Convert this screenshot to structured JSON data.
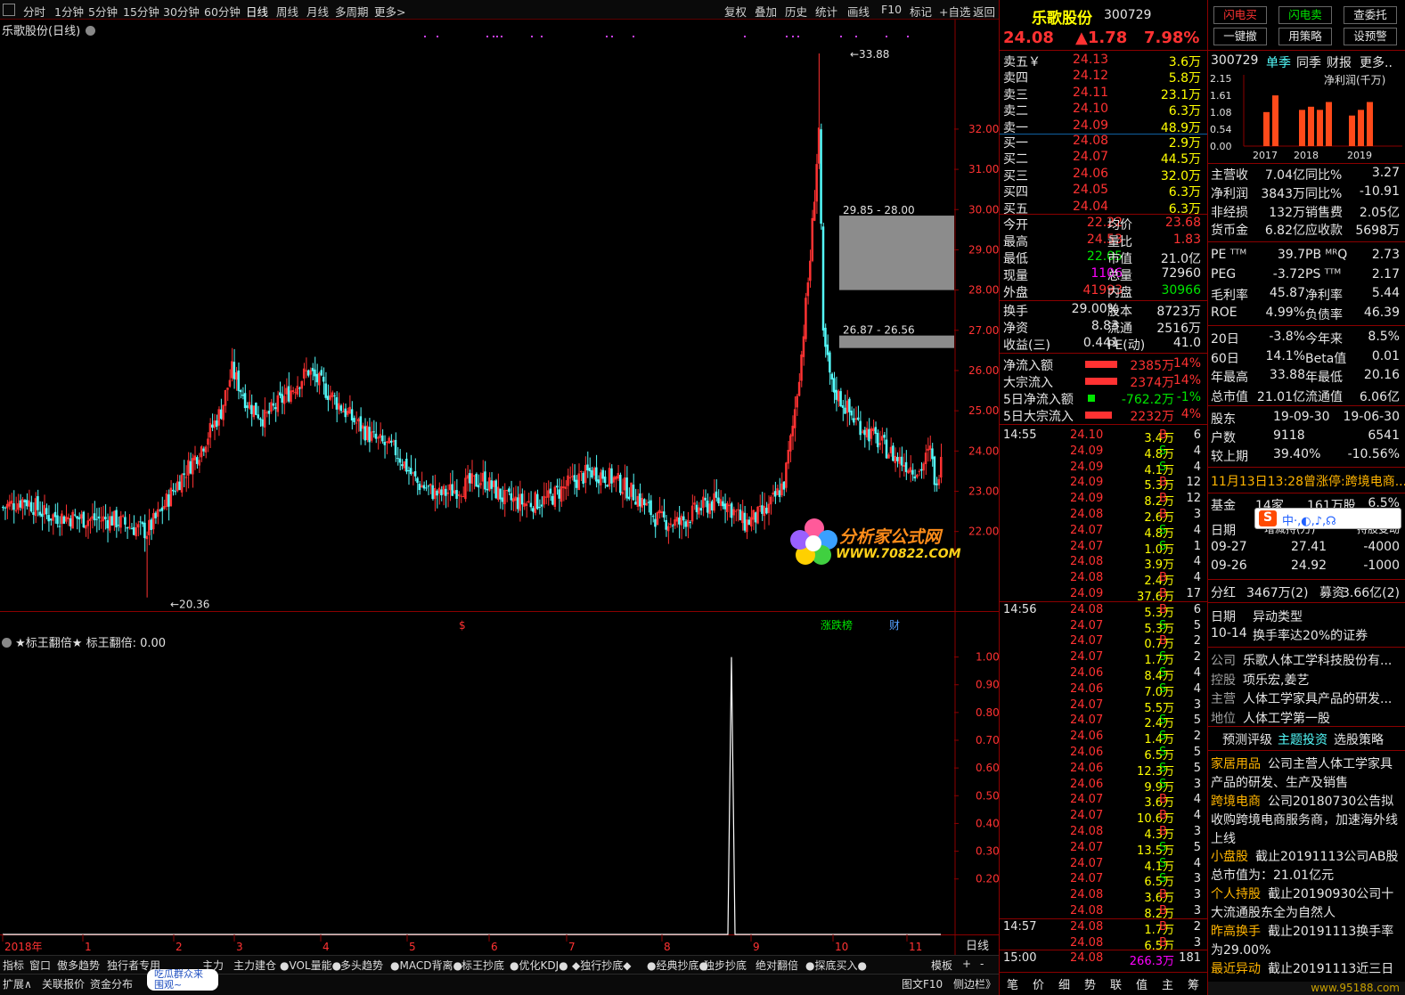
{
  "toolbar": {
    "period_tabs": [
      "分时",
      "1分钟",
      "5分钟",
      "15分钟",
      "30分钟",
      "60分钟",
      "日线",
      "周线",
      "月线",
      "多周期",
      "更多>"
    ],
    "active_tab": "日线",
    "right_buttons": [
      "复权",
      "叠加",
      "历史",
      "统计",
      "画线",
      "F10",
      "标记",
      "+自选",
      "返回"
    ]
  },
  "chart_title": "乐歌股份(日线)",
  "indicator_title": "★标王翻倍★ 标王翻倍: 0.00",
  "period_label": "日线",
  "chart_data": [
    {
      "type": "candlestick",
      "title": "乐歌股份(日线)",
      "x": [
        "2018年",
        "1",
        "2",
        "3",
        "4",
        "5",
        "6",
        "7",
        "8",
        "9",
        "10",
        "11"
      ],
      "ylim": [
        20.0,
        34.5
      ],
      "yticks": [
        22.0,
        23.0,
        24.0,
        25.0,
        26.0,
        27.0,
        28.0,
        29.0,
        30.0,
        31.0,
        32.0
      ],
      "annotations": [
        "33.88",
        "20.36",
        "29.85 - 28.00",
        "26.87 - 26.56"
      ],
      "gap_zones": [
        {
          "label": "29.85 - 28.00",
          "high": 29.85,
          "low": 28.0
        },
        {
          "label": "26.87 - 26.56",
          "high": 26.87,
          "low": 26.56
        }
      ],
      "high": 33.88,
      "low": 20.36,
      "up_color": "#ff3232",
      "down_color": "#54fcfc",
      "markers": [
        "$",
        "涨跌榜",
        "财"
      ]
    },
    {
      "type": "line",
      "title": "★标王翻倍★ 标王翻倍: 0.00",
      "ylim": [
        0,
        1.05
      ],
      "yticks": [
        0.2,
        0.3,
        0.4,
        0.5,
        0.6,
        0.7,
        0.8,
        0.9,
        1.0
      ],
      "signal": {
        "x_month": "8",
        "value": 1.0
      },
      "line_color": "#ffffff"
    }
  ],
  "xaxis_labels": [
    "2018年",
    "1",
    "2",
    "3",
    "4",
    "5",
    "6",
    "7",
    "8",
    "9",
    "10",
    "11"
  ],
  "price_ticks": [
    "32.00",
    "31.00",
    "30.00",
    "29.00",
    "28.00",
    "27.00",
    "26.00",
    "25.00",
    "24.00",
    "23.00",
    "22.00"
  ],
  "ind_ticks": [
    "1.00",
    "0.90",
    "0.80",
    "0.70",
    "0.60",
    "0.50",
    "0.40",
    "0.30",
    "0.20"
  ],
  "annotations": {
    "high": "33.88",
    "low": "20.36",
    "gap1": "29.85 - 28.00",
    "gap2": "26.87 - 26.56",
    "dollar": "$",
    "zdb": "涨跌榜",
    "cai": "财"
  },
  "watermark": {
    "line1": "分析家公式网",
    "line2": "WWW.70822.COM"
  },
  "bottom_tabs_row1": [
    "指标",
    "窗口",
    "傲多趋势",
    "独行者专用",
    "主力",
    "主力建仓",
    "●VOL量能●",
    "多头趋势",
    "●MACD背离●",
    "标王抄底",
    "●优化KDJ●",
    "◆独行抄底◆",
    "●经典抄底●",
    "独步抄底",
    "绝对翻倍",
    "●探底买入●",
    "模板",
    "+",
    "-"
  ],
  "bottom_tabs_row2": [
    "扩展∧",
    "关联报价",
    "资金分布",
    "吃瓜群众来围观~",
    "图文F10",
    "侧边栏》"
  ],
  "stock": {
    "name": "乐歌股份",
    "code": "300729",
    "price": "24.08",
    "change": "▲1.78",
    "pct": "7.98%"
  },
  "asks": [
    {
      "label": "卖五￥",
      "price": "24.13",
      "vol": "3.6万"
    },
    {
      "label": "卖四",
      "price": "24.12",
      "vol": "5.8万"
    },
    {
      "label": "卖三",
      "price": "24.11",
      "vol": "23.1万"
    },
    {
      "label": "卖二",
      "price": "24.10",
      "vol": "6.3万"
    },
    {
      "label": "卖一",
      "price": "24.09",
      "vol": "48.9万"
    }
  ],
  "bids": [
    {
      "label": "买一",
      "price": "24.08",
      "vol": "2.9万"
    },
    {
      "label": "买二",
      "price": "24.07",
      "vol": "44.5万"
    },
    {
      "label": "买三",
      "price": "24.06",
      "vol": "32.0万"
    },
    {
      "label": "买四",
      "price": "24.05",
      "vol": "6.3万"
    },
    {
      "label": "买五",
      "price": "24.04",
      "vol": "6.3万"
    }
  ],
  "quote": [
    {
      "l": "今开",
      "v": "22.22",
      "l2": "均价",
      "v2": "23.68"
    },
    {
      "l": "最高",
      "v": "24.53",
      "l2": "量比",
      "v2": "1.83"
    },
    {
      "l": "最低",
      "v": "22.05",
      "l2": "市值",
      "v2": "21.0亿"
    },
    {
      "l": "现量",
      "v": "1106",
      "l2": "总量",
      "v2": "72960"
    },
    {
      "l": "外盘",
      "v": "41993",
      "l2": "内盘",
      "v2": "30966"
    }
  ],
  "quote2": [
    {
      "l": "换手",
      "v": "29.00%",
      "l2": "股本",
      "v2": "8723万"
    },
    {
      "l": "净资",
      "v": "8.83",
      "l2": "流通",
      "v2": "2516万"
    },
    {
      "l": "收益(三)",
      "v": "0.441",
      "l2": "PE(动)",
      "v2": "41.0"
    }
  ],
  "flows": [
    {
      "l": "净流入额",
      "v": "2385万",
      "p": "14%",
      "bar": "red",
      "w": 0.9
    },
    {
      "l": "大宗流入",
      "v": "2374万",
      "p": "14%",
      "bar": "red",
      "w": 0.9
    },
    {
      "l": "5日净流入额",
      "v": "-762.2万",
      "p": "-1%",
      "bar": "green",
      "w": 0.2
    },
    {
      "l": "5日大宗流入",
      "v": "2232万",
      "p": "4%",
      "bar": "red",
      "w": 0.75
    }
  ],
  "ticks": [
    {
      "t": "14:55",
      "p": "24.10",
      "v": "3.4万",
      "d": "B",
      "n": "6"
    },
    {
      "t": "",
      "p": "24.09",
      "v": "4.8万",
      "d": "S",
      "n": "4"
    },
    {
      "t": "",
      "p": "24.09",
      "v": "4.1万",
      "d": "S",
      "n": "4"
    },
    {
      "t": "",
      "p": "24.09",
      "v": "5.3万",
      "d": "B",
      "n": "12"
    },
    {
      "t": "",
      "p": "24.09",
      "v": "8.2万",
      "d": "B",
      "n": "12"
    },
    {
      "t": "",
      "p": "24.08",
      "v": "2.6万",
      "d": "B",
      "n": "3"
    },
    {
      "t": "",
      "p": "24.07",
      "v": "4.8万",
      "d": "S",
      "n": "4"
    },
    {
      "t": "",
      "p": "24.07",
      "v": "1.0万",
      "d": "S",
      "n": "1"
    },
    {
      "t": "",
      "p": "24.08",
      "v": "3.9万",
      "d": "",
      "n": "4"
    },
    {
      "t": "",
      "p": "24.08",
      "v": "2.4万",
      "d": "B",
      "n": "4"
    },
    {
      "t": "",
      "p": "24.09",
      "v": "37.6万",
      "d": "B",
      "n": "17"
    },
    {
      "t": "14:56",
      "p": "24.08",
      "v": "5.3万",
      "d": "B",
      "n": "6"
    },
    {
      "t": "",
      "p": "24.07",
      "v": "5.3万",
      "d": "S",
      "n": "5"
    },
    {
      "t": "",
      "p": "24.07",
      "v": "0.7万",
      "d": "B",
      "n": "2"
    },
    {
      "t": "",
      "p": "24.07",
      "v": "1.7万",
      "d": "S",
      "n": "2"
    },
    {
      "t": "",
      "p": "24.06",
      "v": "8.4万",
      "d": "S",
      "n": "4"
    },
    {
      "t": "",
      "p": "24.06",
      "v": "7.0万",
      "d": "S",
      "n": "4"
    },
    {
      "t": "",
      "p": "24.07",
      "v": "5.5万",
      "d": "",
      "n": "3"
    },
    {
      "t": "",
      "p": "24.07",
      "v": "2.4万",
      "d": "S",
      "n": "5"
    },
    {
      "t": "",
      "p": "24.06",
      "v": "1.4万",
      "d": "S",
      "n": "2"
    },
    {
      "t": "",
      "p": "24.06",
      "v": "6.5万",
      "d": "S",
      "n": "5"
    },
    {
      "t": "",
      "p": "24.06",
      "v": "12.3万",
      "d": "S",
      "n": "5"
    },
    {
      "t": "",
      "p": "24.06",
      "v": "9.9万",
      "d": "S",
      "n": "3"
    },
    {
      "t": "",
      "p": "24.07",
      "v": "3.6万",
      "d": "B",
      "n": "4"
    },
    {
      "t": "",
      "p": "24.07",
      "v": "10.6万",
      "d": "B",
      "n": "4"
    },
    {
      "t": "",
      "p": "24.08",
      "v": "4.3万",
      "d": "B",
      "n": "3"
    },
    {
      "t": "",
      "p": "24.07",
      "v": "13.5万",
      "d": "S",
      "n": "5"
    },
    {
      "t": "",
      "p": "24.07",
      "v": "4.1万",
      "d": "S",
      "n": "4"
    },
    {
      "t": "",
      "p": "24.07",
      "v": "6.5万",
      "d": "S",
      "n": "3"
    },
    {
      "t": "",
      "p": "24.08",
      "v": "3.6万",
      "d": "B",
      "n": "3"
    },
    {
      "t": "",
      "p": "24.08",
      "v": "8.2万",
      "d": "B",
      "n": "3"
    },
    {
      "t": "14:57",
      "p": "24.08",
      "v": "1.7万",
      "d": "B",
      "n": "2"
    },
    {
      "t": "",
      "p": "24.08",
      "v": "6.5万",
      "d": "B",
      "n": "3"
    },
    {
      "t": "15:00",
      "p": "24.08",
      "v": "266.3万",
      "d": "",
      "n": "181"
    }
  ],
  "rp_bottom_tabs": [
    "笔",
    "价",
    "细",
    "势",
    "联",
    "值",
    "主",
    "筹"
  ],
  "fin_buttons_row1": [
    "闪电买",
    "闪电卖",
    "查委托"
  ],
  "fin_buttons_row2": [
    "一键撤",
    "用策略",
    "设预警"
  ],
  "fin_tabs": [
    "300729",
    "单季",
    "同季",
    "财报",
    "更多.."
  ],
  "fin_chart": {
    "type": "bar",
    "title": "净利润(千万)",
    "yticks": [
      "2.15",
      "1.61",
      "1.08",
      "0.54",
      "0.00"
    ],
    "categories": [
      "2017",
      "2018",
      "2019"
    ],
    "values": [
      [
        1.08,
        1.61
      ],
      [
        1.15,
        1.25,
        1.15,
        1.4
      ],
      [
        0.97,
        1.15,
        1.4
      ]
    ]
  },
  "fin_rows1": [
    {
      "l": "主营收",
      "v": "7.04亿",
      "l2": "同比%",
      "v2": "3.27"
    },
    {
      "l": "净利润",
      "v": "3843万",
      "l2": "同比%",
      "v2": "-10.91"
    },
    {
      "l": "非经损",
      "v": "132万",
      "l2": "销售费",
      "v2": "2.05亿"
    },
    {
      "l": "货币金",
      "v": "6.82亿",
      "l2": "应收款",
      "v2": "5698万"
    }
  ],
  "fin_rows2": [
    {
      "l": "PE ᵀᵀᴹ",
      "v": "39.7",
      "l2": "PB ᴹᴿQ",
      "v2": "2.73"
    },
    {
      "l": "PEG",
      "v": "-3.72",
      "l2": "PS ᵀᵀᴹ",
      "v2": "2.17"
    },
    {
      "l": "毛利率",
      "v": "45.87",
      "l2": "净利率",
      "v2": "5.44"
    },
    {
      "l": "ROE",
      "v": "4.99%",
      "l2": "负债率",
      "v2": "46.39"
    }
  ],
  "fin_rows3": [
    {
      "l": "20日",
      "v": "-3.8%",
      "l2": "今年来",
      "v2": "8.5%"
    },
    {
      "l": "60日",
      "v": "14.1%",
      "l2": "Beta值",
      "v2": "0.01"
    },
    {
      "l": "年最高",
      "v": "33.88",
      "l2": "年最低",
      "v2": "20.16"
    },
    {
      "l": "总市值",
      "v": "21.01亿",
      "l2": "流通值",
      "v2": "6.06亿"
    }
  ],
  "holders": [
    {
      "l": "股东",
      "v": "19-09-30",
      "v2": "19-06-30"
    },
    {
      "l": "户数",
      "v": "9118",
      "v2": "6541"
    },
    {
      "l": "较上期",
      "v": "39.40%",
      "v2": "-10.56%"
    }
  ],
  "news": "11月13日13:28曾涨停:跨境电商...",
  "fund": {
    "l": "基金",
    "v": "14家",
    "v2": "161万股",
    "v3": "6.5%"
  },
  "fund_hdr": {
    "a": "日期",
    "b": "增减持(万)",
    "c": "持股变动"
  },
  "fund_rows": [
    {
      "d": "09-27",
      "a": "27.41",
      "c": "-4000"
    },
    {
      "d": "09-26",
      "a": "24.92",
      "c": "-1000"
    }
  ],
  "dividend": {
    "l": "分红",
    "v": "3467万(2)",
    "l2": "募资",
    "v2": "3.66亿(2)"
  },
  "abnormal": {
    "h1": "日期",
    "h2": "异动类型",
    "d": "10-14",
    "t": "换手率达20%的证券"
  },
  "company": [
    {
      "l": "公司",
      "v": "乐歌人体工学科技股份有..."
    },
    {
      "l": "控股",
      "v": "项乐宏,姜艺"
    },
    {
      "l": "主营",
      "v": "人体工学家具产品的研发..."
    },
    {
      "l": "地位",
      "v": "人体工学第一股"
    }
  ],
  "fin_tabs2": [
    "预测评级",
    "主题投资",
    "选股策略"
  ],
  "themes": [
    {
      "k": "家居用品",
      "t": "公司主营人体工学家具产品的研发、生产及销售"
    },
    {
      "k": "跨境电商",
      "t": "公司20180730公告拟收购跨境电商服务商，加速海外线上线"
    },
    {
      "k": "小盘股",
      "t": "截止20191113公司AB股总市值为：21.01亿元"
    },
    {
      "k": "个人持股",
      "t": "截止20190930公司十大流通股东全为自然人"
    },
    {
      "k": "昨高换手",
      "t": "截止20191113换手率为29.00%"
    },
    {
      "k": "最近异动",
      "t": "截止20191113近三日"
    }
  ],
  "ime": {
    "s": "S",
    "t": "中·,◐,♪,☊"
  },
  "footer_site": "www.95188.com"
}
